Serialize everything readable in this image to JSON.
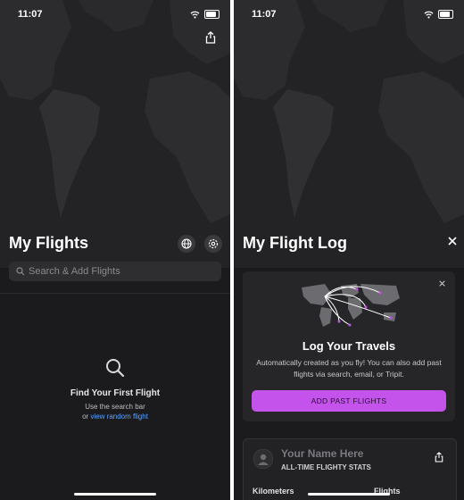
{
  "status": {
    "time": "11:07"
  },
  "left": {
    "title": "My Flights",
    "search_placeholder": "Search & Add Flights",
    "empty_title": "Find Your First Flight",
    "empty_line1": "Use the search bar",
    "empty_or": "or",
    "empty_link": "view random flight"
  },
  "right": {
    "title": "My Flight Log",
    "card": {
      "title": "Log Your Travels",
      "description": "Automatically created as you fly! You can also add past flights via search, email, or Tripit.",
      "button": "ADD PAST FLIGHTS"
    },
    "stats": {
      "name": "Your Name Here",
      "subtitle": "ALL-TIME FLIGHTY STATS",
      "col1": "Kilometers",
      "col2": "Flights"
    }
  },
  "colors": {
    "accent": "#c353eb",
    "link": "#5aa3ff",
    "background": "#1b1b1d"
  },
  "icons": [
    "share-icon",
    "globe-icon",
    "gear-icon",
    "search-icon",
    "close-icon",
    "avatar-icon",
    "wifi-icon",
    "battery-icon"
  ]
}
